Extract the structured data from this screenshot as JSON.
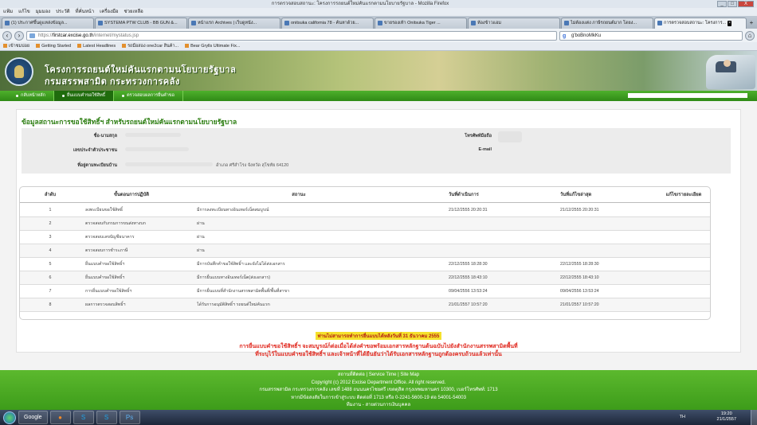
{
  "window": {
    "title": "การตรวจสอบสถานะ: โครงการรถยนต์ใหม่คันแรกตามนโยบายรัฐบาล - Mozilla Firefox",
    "controls": [
      "_",
      "□",
      "X"
    ]
  },
  "menu": [
    "แฟ้ม",
    "แก้ไข",
    "มุมมอง",
    "ประวัติ",
    "ที่คั่นหน้า",
    "เครื่องมือ",
    "ช่วยเหลือ"
  ],
  "tabs": [
    {
      "label": "(1) ประกาศขึ้นดูแหล่งข้อมูล...",
      "active": false
    },
    {
      "label": "SYSTEMA PTW CLUB - BB GUN &...",
      "active": false
    },
    {
      "label": "หน้าแรก Archives | เว็บดูหนัง...",
      "active": false
    },
    {
      "label": "onitsuka california 78 - ค้นหาด้วย...",
      "active": false
    },
    {
      "label": "ขายรองเท้า Onitsuka Tiger ...",
      "active": false
    },
    {
      "label": "ห้องข้าวแอม",
      "active": false
    },
    {
      "label": "ไม่ต้องแต่ง ภาษีรถยนต์มาก โดยง...",
      "active": false
    },
    {
      "label": "การตรวจสอบสถานะ: โครงการ...",
      "active": true
    }
  ],
  "navbar": {
    "url_scheme": "https://",
    "url_host": "firstcar.excise.go.th",
    "url_path": "/internet/mystatus.jsp",
    "search_engine": "g",
    "search_value": "g'boBnoMkKu"
  },
  "bookmarks": [
    "เข้าชมบ่อย",
    "Getting Started",
    "Latest Headlines",
    "รถมือสอง one2car สินค้า...",
    "Bear Grylls Ultimate Fix..."
  ],
  "site": {
    "title_line1": "โครงการรถยนต์ใหม่คันแรกตามนโยบายรัฐบาล",
    "title_line2": "กรมสรรพสามิต กระทรวงการคลัง"
  },
  "site_nav": [
    {
      "label": "กลับหน้าหลัก",
      "active": false
    },
    {
      "label": "ยื่นแบบคำขอใช้สิทธิ์",
      "active": true
    },
    {
      "label": "ตรวจสอบผลการยื่นคำขอ",
      "active": false
    }
  ],
  "status": {
    "heading": "ข้อมูลสถานะการขอใช้สิทธิ์ฯ สำหรับรถยนต์ใหม่คันแรกตามนโยบายรัฐบาล",
    "name_label": "ชื่อ-นามสกุล",
    "idcard_label": "เลขประจำตัวประชาชน",
    "address_label": "ที่อยู่ตามทะเบียนบ้าน",
    "address_value": "อำเภอ ศรีสำโรง จังหวัด สุโขทัย 64120",
    "mobile_label": "โทรศัพท์มือถือ",
    "email_label": "E-mail"
  },
  "table": {
    "headers": [
      "ลำดับ",
      "ขั้นตอนการปฏิบัติ",
      "สถานะ",
      "วันที่ดำเนินการ",
      "วันที่แก้ไขล่าสุด",
      "แก้ไข/รายละเอียด"
    ],
    "rows": [
      {
        "no": "1",
        "step": "ลงทะเบียนขอใช้สิทธิ์",
        "status": "มีการลงทะเบียนทางอินเทอร์เน็ตสมบูรณ์",
        "done": "21/12/2555 20:20:31",
        "updated": "21/12/2555 20:20:31",
        "has_icon": true
      },
      {
        "no": "2",
        "step": "ตรวจสอบกับกรมการขนส่งทางบก",
        "status": "ผ่าน",
        "done": "",
        "updated": "",
        "has_icon": false
      },
      {
        "no": "3",
        "step": "ตรวจสอบเลขบัญชีธนาคาร",
        "status": "ผ่าน",
        "done": "",
        "updated": "",
        "has_icon": false
      },
      {
        "no": "4",
        "step": "ตรวจสอบการชำระภาษี",
        "status": "ผ่าน",
        "done": "",
        "updated": "",
        "has_icon": false
      },
      {
        "no": "5",
        "step": "ยื่นแบบคำขอใช้สิทธิ์ฯ",
        "status": "มีการบันทึกคำขอใช้สิทธิ์ฯ และยังไม่ได้ส่งเอกสาร",
        "done": "22/12/2555 18:28:30",
        "updated": "22/12/2555 18:28:30",
        "has_icon": true
      },
      {
        "no": "6",
        "step": "ยื่นแบบคำขอใช้สิทธิ์ฯ",
        "status": "มีการยื่นแบบทางอินเทอร์เน็ต(ส่งเอกสาร)",
        "done": "22/12/2555 18:43:10",
        "updated": "22/12/2555 18:43:10",
        "has_icon": true
      },
      {
        "no": "7",
        "step": "การยื่นแบบคำขอใช้สิทธิ์ฯ",
        "status": "มีการยื่นแบบที่สำนักงานสรรพสามิตพื้นที่/พื้นที่สาขา",
        "done": "09/04/2556 13:53:24",
        "updated": "09/04/2556 13:53:24",
        "has_icon": false
      },
      {
        "no": "8",
        "step": "ผลการตรวจสอบสิทธิ์ฯ",
        "status": "ได้รับการอนุมัติสิทธิ์ฯ รถยนต์ใหม่คันแรก",
        "done": "21/01/2557 10:57:20",
        "updated": "21/01/2557 10:57:20",
        "has_icon": false
      }
    ]
  },
  "notes": {
    "deadline": "ท่านไม่สามารถทำการยื่นแบบได้หลังวันที่ 31 ธันวาคม 2555",
    "line1": "การยื่นแบบคำขอใช้สิทธิ์ฯ จะสมบูรณ์ก็ต่อเมื่อได้ส่งคำขอพร้อมเอกสารหลักฐานต้นฉบับไปยังสำนักงานสรรพสามิตพื้นที่",
    "line2": "ที่ระบุไว้ในแบบคำขอใช้สิทธิ์ฯ และเจ้าหน้าที่ได้ยืนยันว่าได้รับเอกสารหลักฐานถูกต้องครบถ้วนแล้วเท่านั้น"
  },
  "footer": {
    "links": [
      "สถานที่ติดต่อ",
      "Service Time",
      "Site Map"
    ],
    "copyright": "Copyright (c) 2012 Excise Department Office. All right reserved.",
    "address": "กรมสรรพสามิต กระทรวงการคลัง เลขที่ 1488 ถนนนครไชยศรี เขตดุสิต กรุงเทพมหานคร 10300, เบอร์โทรศัพท์: 1713",
    "contact": "หากมีข้อสงสัยในการเข้าสู่ระบบ ติดต่อที่ 1713 หรือ 0-2241-5600-19 ต่อ 54001-54003",
    "extra": "ทีมงาน - สายด่วนการเงินบุคคล"
  },
  "taskbar": {
    "apps": [
      "Google",
      "Firefox",
      "Skype",
      "Skype",
      "Photoshop"
    ],
    "lang": "TH",
    "time": "19:20",
    "date": "21/1/2557"
  }
}
